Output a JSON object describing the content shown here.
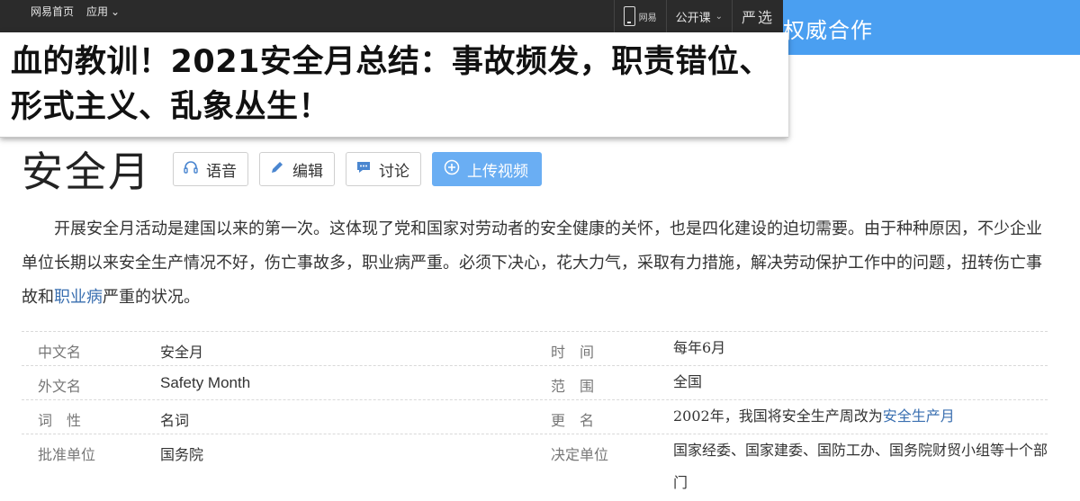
{
  "topbar": {
    "nav": [
      {
        "label": "网易首页"
      },
      {
        "label": "应用",
        "caret": "⌄"
      }
    ],
    "app_label": "网易",
    "opencourse_label": "公开课",
    "opencourse_caret": "⌄",
    "yanxuan_label": "严选"
  },
  "bluebar": {
    "text": "权威合作"
  },
  "headline": {
    "text": "血的教训！2021安全月总结：事故频发，职责错位、形式主义、乱象丛生！"
  },
  "entry": {
    "title": "安全月",
    "buttons": {
      "voice": "语音",
      "edit": "编辑",
      "discuss": "讨论",
      "upload": "上传视频"
    },
    "summary_a": "开展安全月活动是建国以来的第一次。这体现了党和国家对劳动者的安全健康的关怀，也是四化建设的迫切需要。由于种种原因，不少企业单位长期以来安全生产情况不好，伤亡事故多，职业病严重。必须下决心，花大力气，采取有力措施，解决劳动保护工作中的问题，扭转伤亡事故和",
    "summary_link": "职业病",
    "summary_b": "严重的状况。"
  },
  "info": {
    "chinese_name_k": "中文名",
    "chinese_name_v": "安全月",
    "foreign_name_k": "外文名",
    "foreign_name_v": "Safety Month",
    "pos_k": "词　性",
    "pos_v": "名词",
    "approver_k": "批准单位",
    "approver_v": "国务院",
    "time_k": "时　间",
    "time_v": "每年6月",
    "scope_k": "范　围",
    "scope_v": "全国",
    "rename_k": "更　名",
    "rename_v": "2002年，我国将安全生产周改为",
    "rename_link": "安全生产月",
    "decider_k": "决定单位",
    "decider_v": "国家经委、国家建委、国防工办、国务院财贸小组等十个部门"
  },
  "colors": {
    "topbar": "#2b2b2b",
    "accent_blue": "#4a9ff1",
    "link": "#3a6fb0"
  }
}
